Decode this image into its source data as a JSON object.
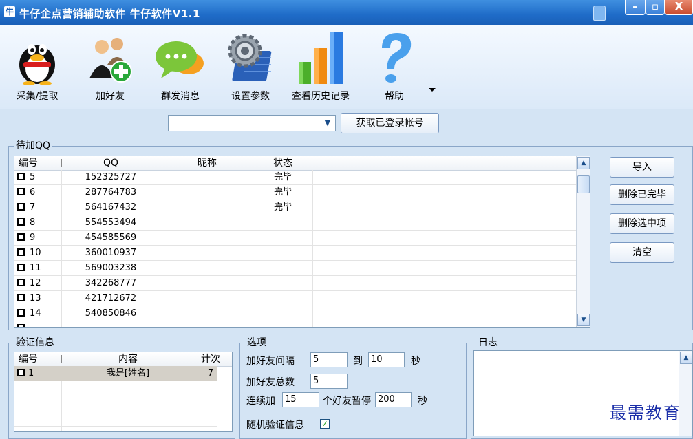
{
  "window": {
    "app_icon_text": "牛",
    "title": "牛仔企点营销辅助软件 牛仔软件V1.1",
    "min_label": "–",
    "max_label": "▫",
    "close_label": "X"
  },
  "toolbar": {
    "items": [
      {
        "label": "采集/提取",
        "icon": "penguin-icon"
      },
      {
        "label": "加好友",
        "icon": "add-friend-icon"
      },
      {
        "label": "群发消息",
        "icon": "chat-bubbles-icon"
      },
      {
        "label": "设置参数",
        "icon": "settings-gear-icon"
      },
      {
        "label": "查看历史记录",
        "icon": "bar-chart-icon"
      },
      {
        "label": "帮助",
        "icon": "help-question-icon"
      }
    ]
  },
  "account": {
    "combo_value": "",
    "get_button": "获取已登录帐号"
  },
  "pending": {
    "group_title": "待加QQ",
    "headers": [
      "编号",
      "QQ",
      "昵称",
      "状态"
    ],
    "rows": [
      {
        "id": "5",
        "qq": "152325727",
        "nick": "",
        "status": "完毕"
      },
      {
        "id": "6",
        "qq": "287764783",
        "nick": "",
        "status": "完毕"
      },
      {
        "id": "7",
        "qq": "564167432",
        "nick": "",
        "status": "完毕"
      },
      {
        "id": "8",
        "qq": "554553494",
        "nick": "",
        "status": ""
      },
      {
        "id": "9",
        "qq": "454585569",
        "nick": "",
        "status": ""
      },
      {
        "id": "10",
        "qq": "360010937",
        "nick": "",
        "status": ""
      },
      {
        "id": "11",
        "qq": "569003238",
        "nick": "",
        "status": ""
      },
      {
        "id": "12",
        "qq": "342268777",
        "nick": "",
        "status": ""
      },
      {
        "id": "13",
        "qq": "421712672",
        "nick": "",
        "status": ""
      },
      {
        "id": "14",
        "qq": "540850846",
        "nick": "",
        "status": ""
      }
    ],
    "buttons": {
      "import": "导入",
      "delete_done": "删除已完毕",
      "delete_selected": "删除选中项",
      "clear": "清空"
    }
  },
  "verify": {
    "group_title": "验证信息",
    "headers": [
      "编号",
      "内容",
      "计次"
    ],
    "rows": [
      {
        "id": "1",
        "content": "我是[姓名]",
        "count": "7"
      }
    ]
  },
  "options": {
    "group_title": "选项",
    "interval_label": "加好友间隔",
    "interval_from": "5",
    "to_label": "到",
    "interval_to": "10",
    "seconds_label": "秒",
    "total_label": "加好友总数",
    "total_value": "5",
    "continuous_label": "连续加",
    "continuous_value": "15",
    "pause_label": "个好友暂停",
    "pause_value": "200",
    "pause_seconds_label": "秒",
    "random_label": "随机验证信息",
    "random_checked": "✓"
  },
  "log": {
    "group_title": "日志"
  },
  "watermark": "最需教育"
}
